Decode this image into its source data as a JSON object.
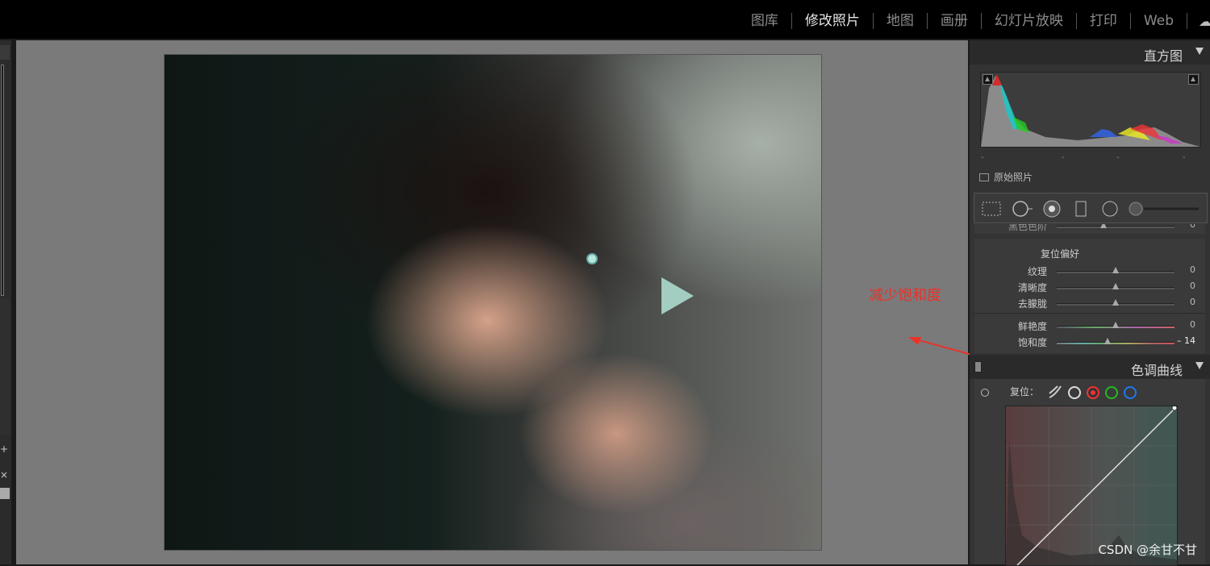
{
  "topbar": {
    "modules": [
      "图库",
      "修改照片",
      "地图",
      "画册",
      "幻灯片放映",
      "打印",
      "Web"
    ],
    "active_module": "修改照片"
  },
  "annotation": {
    "text": "减少饱和度",
    "color": "#e8332a"
  },
  "histogram": {
    "title": "直方图",
    "original_photo_label": "原始照片",
    "tick_marks": [
      "-",
      "-",
      "-",
      "-"
    ]
  },
  "basic_panel": {
    "partial_label": "黑色色阶",
    "partial_value": "0",
    "presence_title": "复位偏好",
    "rows": [
      {
        "label": "纹理",
        "value": "0",
        "position": 0.5
      },
      {
        "label": "清晰度",
        "value": "0",
        "position": 0.5
      },
      {
        "label": "去朦胧",
        "value": "0",
        "position": 0.5
      },
      {
        "label": "鲜艳度",
        "value": "0",
        "position": 0.5
      },
      {
        "label": "饱和度",
        "value": "– 14",
        "position": 0.43
      }
    ]
  },
  "tone_curve": {
    "title": "色调曲线",
    "reset_label": "复位："
  },
  "watermark": "CSDN @余甘不甘"
}
